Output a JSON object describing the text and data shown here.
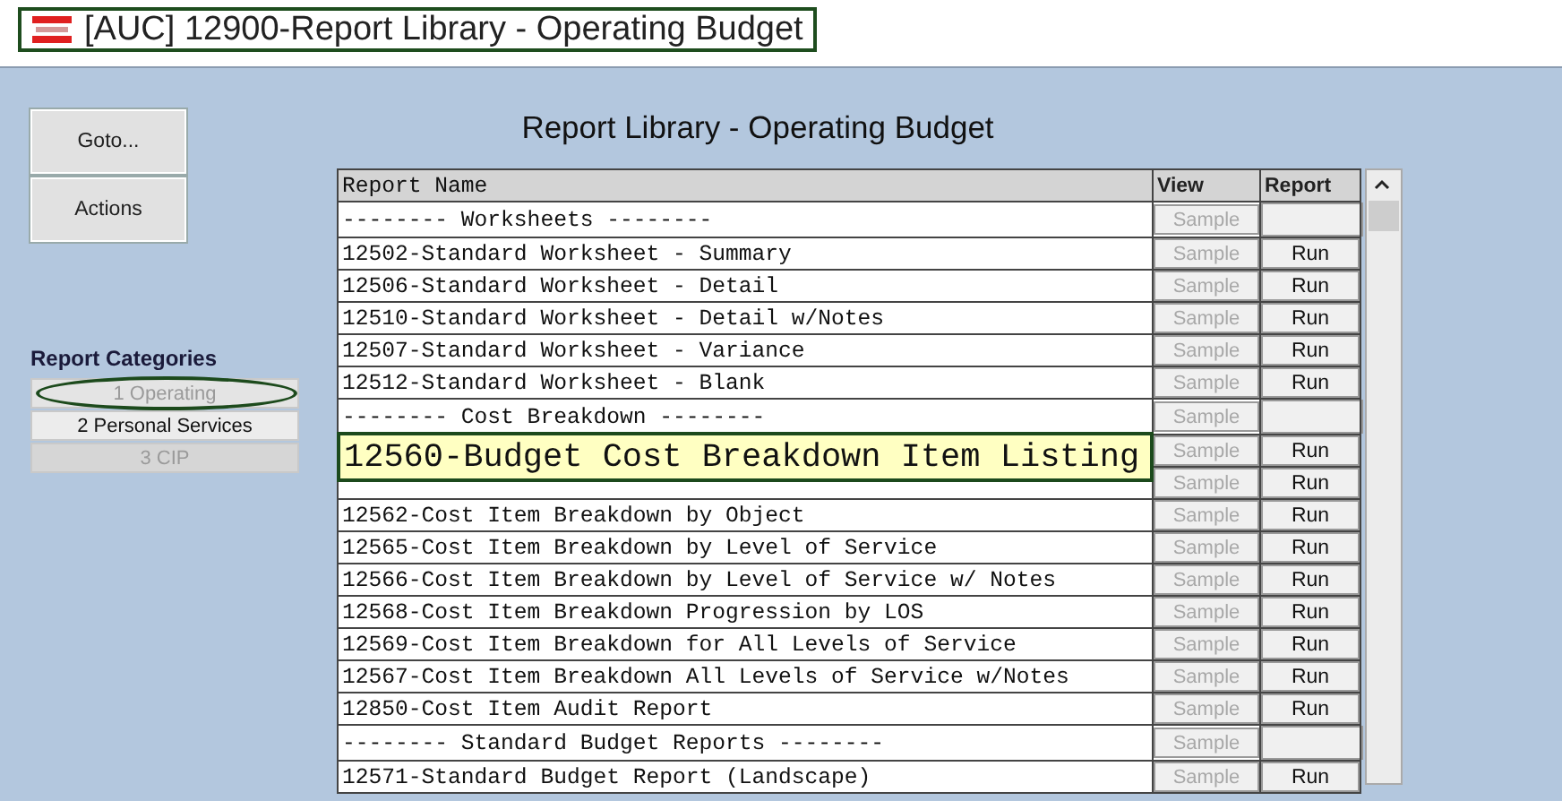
{
  "window": {
    "title": "[AUC] 12900-Report Library - Operating Budget"
  },
  "side_buttons": [
    "Goto...",
    "Actions"
  ],
  "categories": {
    "label": "Report Categories",
    "items": [
      {
        "label": "1 Operating",
        "selected": true,
        "disabled": false
      },
      {
        "label": "2 Personal Services",
        "selected": false,
        "disabled": false
      },
      {
        "label": "3 CIP",
        "selected": false,
        "disabled": true
      }
    ]
  },
  "heading": "Report Library - Operating Budget",
  "table": {
    "columns": [
      "Report Name",
      "View",
      "Report"
    ],
    "rows": [
      {
        "kind": "section",
        "name": "-------- Worksheets --------",
        "view": "Sample"
      },
      {
        "kind": "report",
        "name": "12502-Standard Worksheet - Summary",
        "view": "Sample",
        "report": "Run"
      },
      {
        "kind": "report",
        "name": "12506-Standard Worksheet - Detail",
        "view": "Sample",
        "report": "Run"
      },
      {
        "kind": "report",
        "name": "12510-Standard Worksheet - Detail w/Notes",
        "view": "Sample",
        "report": "Run"
      },
      {
        "kind": "report",
        "name": "12507-Standard Worksheet - Variance",
        "view": "Sample",
        "report": "Run"
      },
      {
        "kind": "report",
        "name": "12512-Standard Worksheet - Blank",
        "view": "Sample",
        "report": "Run"
      },
      {
        "kind": "section",
        "name": "-------- Cost Breakdown --------",
        "view": "Sample"
      },
      {
        "kind": "report",
        "view": "Sample",
        "report": "Run"
      },
      {
        "kind": "report",
        "view": "Sample",
        "report": "Run"
      },
      {
        "kind": "report",
        "name": "12562-Cost Item Breakdown by Object",
        "view": "Sample",
        "report": "Run"
      },
      {
        "kind": "report",
        "name": "12565-Cost Item Breakdown by Level of Service",
        "view": "Sample",
        "report": "Run"
      },
      {
        "kind": "report",
        "name": "12566-Cost Item Breakdown by Level of Service w/ Notes",
        "view": "Sample",
        "report": "Run"
      },
      {
        "kind": "report",
        "name": "12568-Cost Item Breakdown Progression by LOS",
        "view": "Sample",
        "report": "Run"
      },
      {
        "kind": "report",
        "name": "12569-Cost Item Breakdown for All Levels of Service",
        "view": "Sample",
        "report": "Run"
      },
      {
        "kind": "report",
        "name": "12567-Cost Item Breakdown All Levels of Service w/Notes",
        "view": "Sample",
        "report": "Run"
      },
      {
        "kind": "report",
        "name": "12850-Cost Item Audit Report",
        "view": "Sample",
        "report": "Run"
      },
      {
        "kind": "section",
        "name": "-------- Standard Budget Reports --------",
        "view": "Sample"
      },
      {
        "kind": "report",
        "name": "12571-Standard Budget Report (Landscape)",
        "view": "Sample",
        "report": "Run"
      }
    ]
  },
  "tooltip": {
    "text": "12560-Budget Cost Breakdown Item Listing"
  }
}
